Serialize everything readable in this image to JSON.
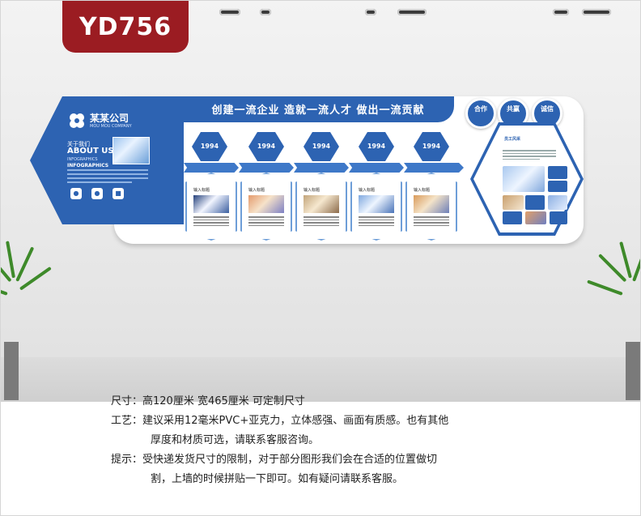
{
  "badge": {
    "code": "YD756"
  },
  "board": {
    "slogan": "创建一流企业  造就一流人才  做出一流贡献",
    "company_name": "某某公司",
    "company_sub": "MOU MOU COMPANY",
    "about_cn": "关于我们",
    "about_en": "ABOUT US",
    "infographics_1": "INFOGRAPHICS",
    "infographics_2": "INFOGRAPHICS",
    "values": [
      {
        "label": "合作"
      },
      {
        "label": "共赢"
      },
      {
        "label": "诚信"
      }
    ],
    "timeline": [
      {
        "year": "1994",
        "title": "输入标题"
      },
      {
        "year": "1994",
        "title": "输入标题"
      },
      {
        "year": "1994",
        "title": "输入标题"
      },
      {
        "year": "1994",
        "title": "输入标题"
      },
      {
        "year": "1994",
        "title": "输入标题"
      }
    ],
    "culture_title": "员工风采"
  },
  "specs": {
    "size_label": "尺寸：",
    "size_value": "高120厘米  宽465厘米  可定制尺寸",
    "craft_label": "工艺：",
    "craft_line1": "建议采用12毫米PVC+亚克力，立体感强、画面有质感。也有其他",
    "craft_line2": "厚度和材质可选，请联系客服咨询。",
    "tip_label": "提示：",
    "tip_line1": "受快递发货尺寸的限制，对于部分图形我们会在合适的位置做切",
    "tip_line2": "割，上墙的时候拼贴一下即可。如有疑问请联系客服。"
  },
  "colors": {
    "brand_blue": "#2d63b2",
    "badge_red": "#9b1c22"
  }
}
